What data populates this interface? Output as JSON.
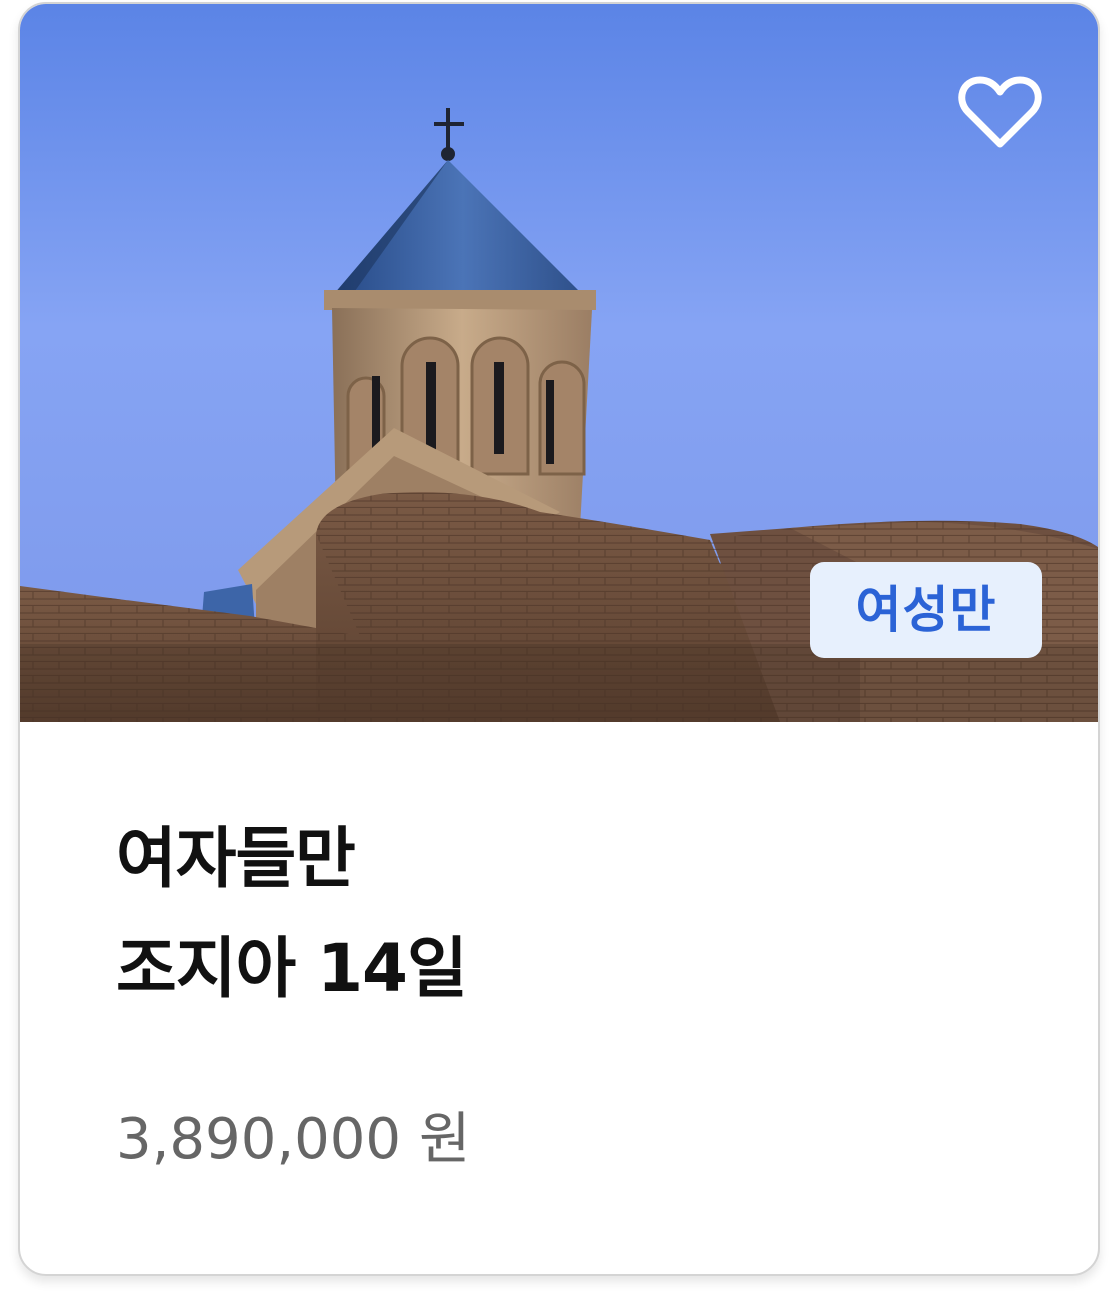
{
  "card": {
    "badge": "여성만",
    "title_line1": "여자들만",
    "title_line2": "조지아 14일",
    "price": "3,890,000",
    "currency": "원"
  },
  "colors": {
    "badge_bg": "#e7f0fd",
    "badge_text": "#2b63d6",
    "title": "#111111",
    "price": "#666666",
    "sky": "#7c9cf0"
  },
  "icons": {
    "favorite": "heart-outline-icon"
  }
}
